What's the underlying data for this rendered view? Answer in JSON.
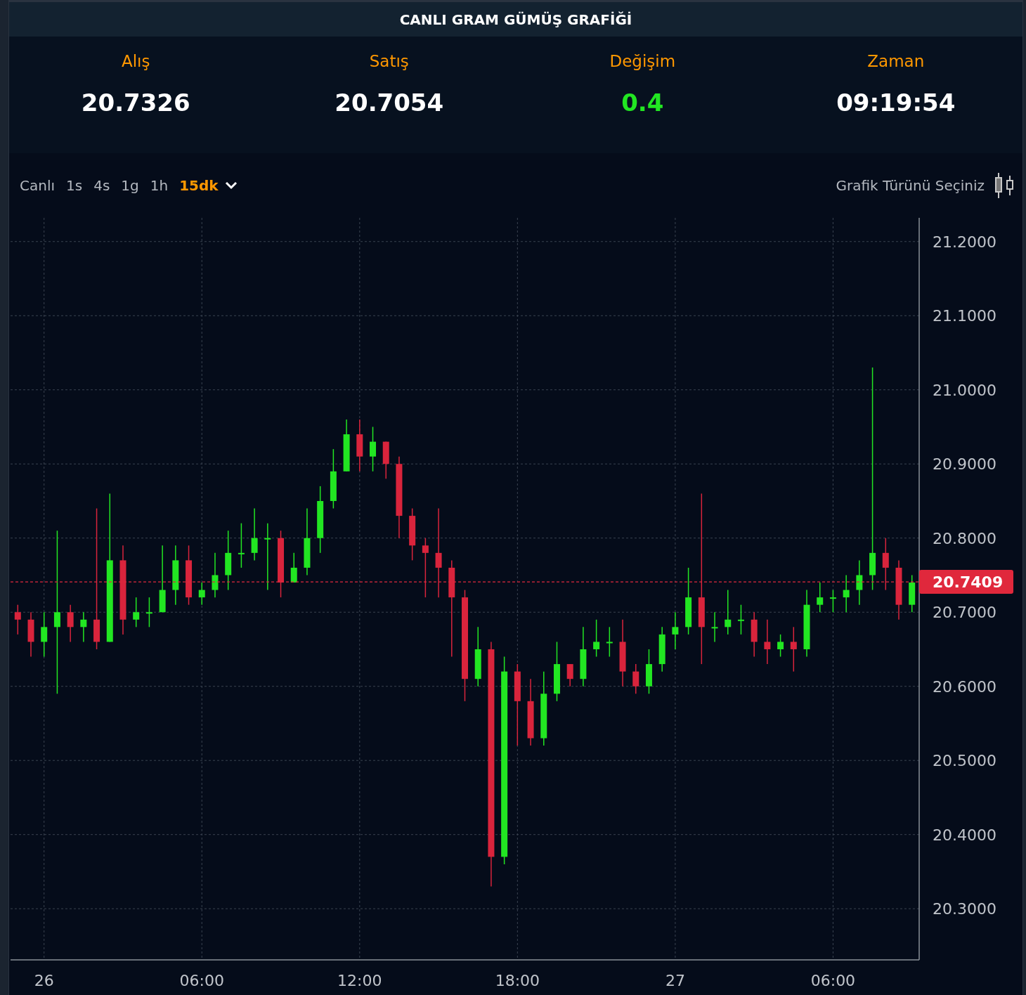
{
  "title": "CANLI GRAM GÜMÜŞ GRAFİĞİ",
  "stats": [
    {
      "label": "Alış",
      "value": "20.7326",
      "kind": "plain"
    },
    {
      "label": "Satış",
      "value": "20.7054",
      "kind": "plain"
    },
    {
      "label": "Değişim",
      "value": "0.4",
      "kind": "up"
    },
    {
      "label": "Zaman",
      "value": "09:19:54",
      "kind": "plain"
    }
  ],
  "intervals": [
    {
      "label": "Canlı",
      "selected": false
    },
    {
      "label": "1s",
      "selected": false
    },
    {
      "label": "4s",
      "selected": false
    },
    {
      "label": "1g",
      "selected": false
    },
    {
      "label": "1h",
      "selected": false
    },
    {
      "label": "15dk",
      "selected": true
    }
  ],
  "chart_type_label": "Grafik Türünü Seçiniz",
  "chart": {
    "chart_data": {
      "type": "candlestick",
      "grid": true,
      "ylim": [
        20.231,
        21.232
      ],
      "ref_lines": [
        {
          "axis": "y",
          "value": 20.7409,
          "label": "20.7409"
        }
      ],
      "yticks": [
        {
          "value": 20.3,
          "label": "20.3000"
        },
        {
          "value": 20.4,
          "label": "20.4000"
        },
        {
          "value": 20.5,
          "label": "20.5000"
        },
        {
          "value": 20.6,
          "label": "20.6000"
        },
        {
          "value": 20.7,
          "label": "20.7000"
        },
        {
          "value": 20.8,
          "label": "20.8000"
        },
        {
          "value": 20.9,
          "label": "20.9000"
        },
        {
          "value": 21.0,
          "label": "21.0000"
        },
        {
          "value": 21.1,
          "label": "21.1000"
        },
        {
          "value": 21.2,
          "label": "21.2000"
        }
      ],
      "categories": [
        null,
        null,
        "26",
        null,
        null,
        null,
        null,
        null,
        null,
        null,
        null,
        null,
        null,
        null,
        "06:00",
        null,
        null,
        null,
        null,
        null,
        null,
        null,
        null,
        null,
        null,
        null,
        "12:00",
        null,
        null,
        null,
        null,
        null,
        null,
        null,
        null,
        null,
        null,
        null,
        "18:00",
        null,
        null,
        null,
        null,
        null,
        null,
        null,
        null,
        null,
        null,
        null,
        "27",
        null,
        null,
        null,
        null,
        null,
        null,
        null,
        null,
        null,
        null,
        null,
        "06:00",
        null,
        null,
        null,
        null,
        null,
        null
      ],
      "ohlc": [
        [
          20.7,
          20.71,
          20.67,
          20.69
        ],
        [
          20.69,
          20.7,
          20.64,
          20.66
        ],
        [
          20.66,
          20.7,
          20.64,
          20.68
        ],
        [
          20.68,
          20.81,
          20.59,
          20.7
        ],
        [
          20.7,
          20.71,
          20.66,
          20.68
        ],
        [
          20.68,
          20.7,
          20.66,
          20.69
        ],
        [
          20.69,
          20.84,
          20.65,
          20.66
        ],
        [
          20.66,
          20.86,
          20.66,
          20.77
        ],
        [
          20.77,
          20.79,
          20.67,
          20.69
        ],
        [
          20.69,
          20.72,
          20.68,
          20.7
        ],
        [
          20.7,
          20.72,
          20.68,
          20.7
        ],
        [
          20.7,
          20.79,
          20.7,
          20.73
        ],
        [
          20.73,
          20.79,
          20.71,
          20.77
        ],
        [
          20.77,
          20.79,
          20.71,
          20.72
        ],
        [
          20.72,
          20.74,
          20.71,
          20.73
        ],
        [
          20.73,
          20.78,
          20.72,
          20.75
        ],
        [
          20.75,
          20.81,
          20.73,
          20.78
        ],
        [
          20.78,
          20.82,
          20.76,
          20.78
        ],
        [
          20.78,
          20.84,
          20.77,
          20.8
        ],
        [
          20.8,
          20.82,
          20.73,
          20.8
        ],
        [
          20.8,
          20.81,
          20.72,
          20.74
        ],
        [
          20.74,
          20.78,
          20.74,
          20.76
        ],
        [
          20.76,
          20.84,
          20.75,
          20.8
        ],
        [
          20.8,
          20.87,
          20.78,
          20.85
        ],
        [
          20.85,
          20.92,
          20.84,
          20.89
        ],
        [
          20.89,
          20.96,
          20.89,
          20.94
        ],
        [
          20.94,
          20.96,
          20.89,
          20.91
        ],
        [
          20.91,
          20.95,
          20.89,
          20.93
        ],
        [
          20.93,
          20.93,
          20.88,
          20.9
        ],
        [
          20.9,
          20.91,
          20.8,
          20.83
        ],
        [
          20.83,
          20.84,
          20.77,
          20.79
        ],
        [
          20.79,
          20.8,
          20.72,
          20.78
        ],
        [
          20.78,
          20.84,
          20.72,
          20.76
        ],
        [
          20.76,
          20.77,
          20.64,
          20.72
        ],
        [
          20.72,
          20.73,
          20.58,
          20.61
        ],
        [
          20.61,
          20.68,
          20.6,
          20.65
        ],
        [
          20.65,
          20.66,
          20.33,
          20.37
        ],
        [
          20.37,
          20.64,
          20.36,
          20.62
        ],
        [
          20.62,
          20.63,
          20.52,
          20.58
        ],
        [
          20.58,
          20.61,
          20.52,
          20.53
        ],
        [
          20.53,
          20.62,
          20.52,
          20.59
        ],
        [
          20.59,
          20.66,
          20.58,
          20.63
        ],
        [
          20.63,
          20.63,
          20.6,
          20.61
        ],
        [
          20.61,
          20.68,
          20.6,
          20.65
        ],
        [
          20.65,
          20.69,
          20.64,
          20.66
        ],
        [
          20.66,
          20.68,
          20.64,
          20.66
        ],
        [
          20.66,
          20.69,
          20.6,
          20.62
        ],
        [
          20.62,
          20.63,
          20.59,
          20.6
        ],
        [
          20.6,
          20.65,
          20.59,
          20.63
        ],
        [
          20.63,
          20.68,
          20.62,
          20.67
        ],
        [
          20.67,
          20.7,
          20.65,
          20.68
        ],
        [
          20.68,
          20.76,
          20.67,
          20.72
        ],
        [
          20.72,
          20.86,
          20.63,
          20.68
        ],
        [
          20.68,
          20.7,
          20.66,
          20.68
        ],
        [
          20.68,
          20.73,
          20.67,
          20.69
        ],
        [
          20.69,
          20.71,
          20.67,
          20.69
        ],
        [
          20.69,
          20.7,
          20.64,
          20.66
        ],
        [
          20.66,
          20.69,
          20.63,
          20.65
        ],
        [
          20.65,
          20.67,
          20.64,
          20.66
        ],
        [
          20.66,
          20.68,
          20.62,
          20.65
        ],
        [
          20.65,
          20.73,
          20.64,
          20.71
        ],
        [
          20.71,
          20.74,
          20.7,
          20.72
        ],
        [
          20.72,
          20.73,
          20.7,
          20.72
        ],
        [
          20.72,
          20.75,
          20.7,
          20.73
        ],
        [
          20.73,
          20.77,
          20.71,
          20.75
        ],
        [
          20.75,
          21.03,
          20.73,
          20.78
        ],
        [
          20.78,
          20.8,
          20.73,
          20.76
        ],
        [
          20.76,
          20.77,
          20.69,
          20.71
        ],
        [
          20.71,
          20.75,
          20.7,
          20.74
        ]
      ]
    }
  }
}
